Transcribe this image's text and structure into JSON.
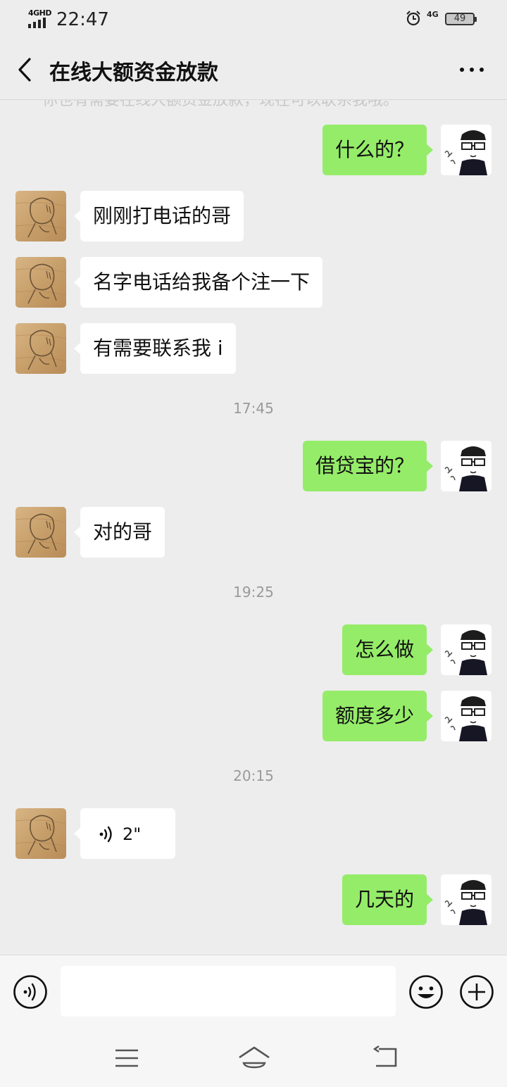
{
  "status_bar": {
    "network": "4GHD",
    "time": "22:47",
    "network2": "4G",
    "battery": "49"
  },
  "header": {
    "title": "在线大额资金放款"
  },
  "faded_line": "你也有需要在线大额资金放款，现在可以联系我哦。",
  "messages": [
    {
      "side": "right",
      "text": "什么的？"
    },
    {
      "side": "left",
      "text": "刚刚打电话的哥"
    },
    {
      "side": "left",
      "text": "名字电话给我备个注一下"
    },
    {
      "side": "left",
      "text": "有需要联系我 i"
    },
    {
      "timestamp": "17:45"
    },
    {
      "side": "right",
      "text": "借贷宝的？"
    },
    {
      "side": "left",
      "text": "对的哥"
    },
    {
      "timestamp": "19:25"
    },
    {
      "side": "right",
      "text": "怎么做"
    },
    {
      "side": "right",
      "text": "额度多少"
    },
    {
      "timestamp": "20:15"
    },
    {
      "side": "left",
      "voice": "2\""
    },
    {
      "side": "right",
      "text": "几天的"
    }
  ],
  "input": {
    "value": "",
    "placeholder": ""
  },
  "colors": {
    "background": "#ededed",
    "sent_bubble": "#95ec69",
    "received_bubble": "#ffffff",
    "timestamp": "#9a9a9a"
  }
}
